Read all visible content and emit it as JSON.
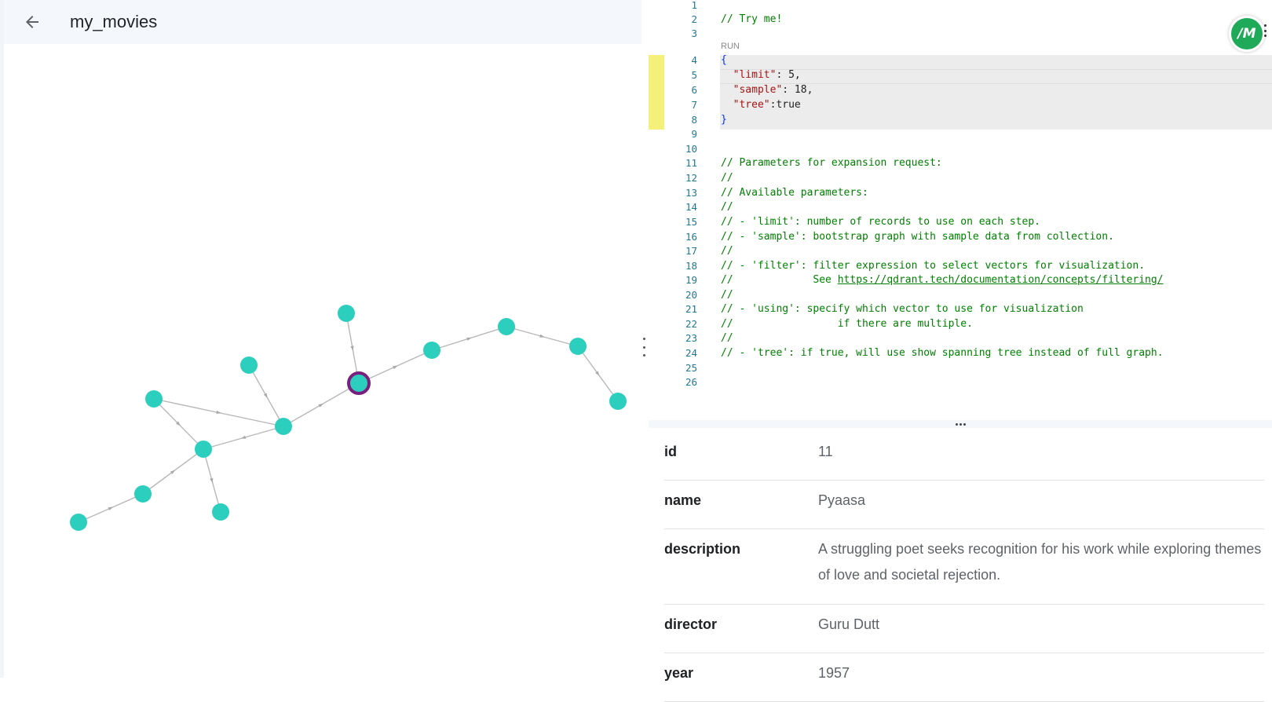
{
  "header": {
    "title": "my_movies"
  },
  "editor": {
    "run_label": "RUN",
    "lines": [
      {
        "n": "1",
        "text": ""
      },
      {
        "n": "2",
        "text": "// Try me!"
      },
      {
        "n": "3",
        "text": ""
      },
      {
        "n": "4",
        "text": "{"
      },
      {
        "n": "5",
        "text": "  \"limit\": 5,"
      },
      {
        "n": "6",
        "text": "  \"sample\": 18,"
      },
      {
        "n": "7",
        "text": "  \"tree\":true"
      },
      {
        "n": "8",
        "text": "}"
      },
      {
        "n": "9",
        "text": ""
      },
      {
        "n": "10",
        "text": ""
      },
      {
        "n": "11",
        "text": "// Parameters for expansion request:"
      },
      {
        "n": "12",
        "text": "//"
      },
      {
        "n": "13",
        "text": "// Available parameters:"
      },
      {
        "n": "14",
        "text": "//"
      },
      {
        "n": "15",
        "text": "// - 'limit': number of records to use on each step."
      },
      {
        "n": "16",
        "text": "// - 'sample': bootstrap graph with sample data from collection."
      },
      {
        "n": "17",
        "text": "//"
      },
      {
        "n": "18",
        "text": "// - 'filter': filter expression to select vectors for visualization."
      },
      {
        "n": "19",
        "text": "//             See ",
        "link": "https://qdrant.tech/documentation/concepts/filtering/"
      },
      {
        "n": "20",
        "text": "//"
      },
      {
        "n": "21",
        "text": "// - 'using': specify which vector to use for visualization"
      },
      {
        "n": "22",
        "text": "//                 if there are multiple."
      },
      {
        "n": "23",
        "text": "//"
      },
      {
        "n": "24",
        "text": "// - 'tree': if true, will use show spanning tree instead of full graph."
      },
      {
        "n": "25",
        "text": ""
      },
      {
        "n": "26",
        "text": ""
      }
    ]
  },
  "avatar": {
    "initials": "/M",
    "color": "#1faa59"
  },
  "properties": [
    {
      "key": "id",
      "value": "11"
    },
    {
      "key": "name",
      "value": "Pyaasa"
    },
    {
      "key": "description",
      "value": "A struggling poet seeks recognition for his work while exploring themes of love and societal rejection."
    },
    {
      "key": "director",
      "value": "Guru Dutt"
    },
    {
      "key": "year",
      "value": "1957"
    }
  ],
  "graph": {
    "node_color": "#2ccfbd",
    "selected_ring_color": "#7a1f7e",
    "edge_color": "#b8b8b8",
    "selected_node": "n5",
    "edges": [
      [
        "n1",
        "n5"
      ],
      [
        "n5",
        "n6"
      ],
      [
        "n6",
        "n7"
      ],
      [
        "n7",
        "n8"
      ],
      [
        "n8",
        "n9"
      ],
      [
        "n4",
        "n3"
      ],
      [
        "n3",
        "n5"
      ],
      [
        "n2",
        "n3"
      ],
      [
        "n10",
        "n11"
      ],
      [
        "n11",
        "n12"
      ],
      [
        "n12",
        "n13"
      ],
      [
        "n14",
        "n12"
      ],
      [
        "n15",
        "n12"
      ]
    ]
  }
}
